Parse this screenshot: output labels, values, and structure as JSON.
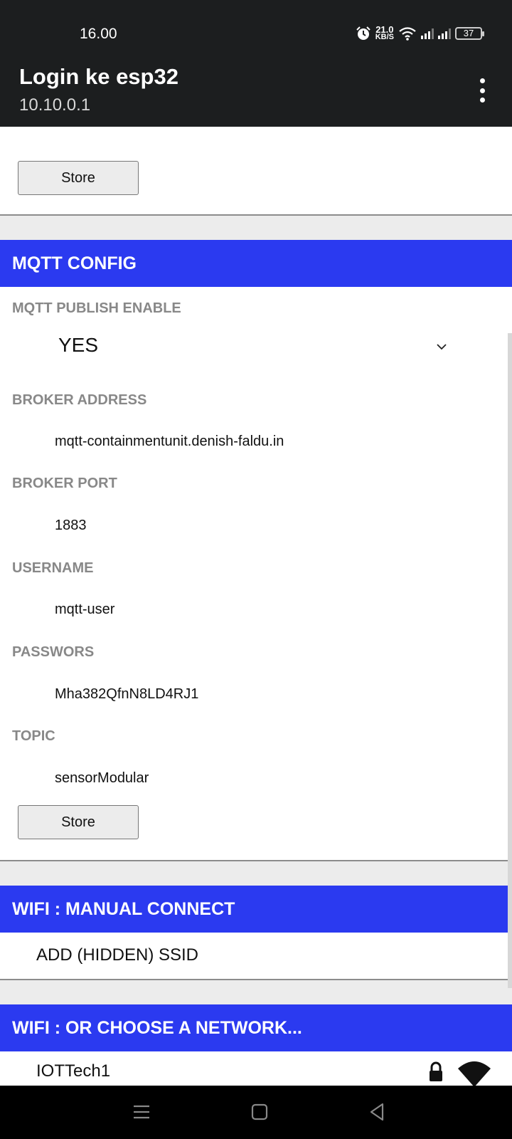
{
  "status_bar": {
    "time": "16.00",
    "net_speed_value": "21.0",
    "net_speed_unit": "KB/S",
    "battery": "37",
    "icons": [
      "alarm-icon",
      "wifi-icon",
      "signal-icon",
      "signal-icon",
      "battery-icon"
    ]
  },
  "app_bar": {
    "title": "Login ke esp32",
    "subtitle": "10.10.0.1",
    "menu_icon": "more-vert-icon"
  },
  "top_section": {
    "store_label": "Store"
  },
  "mqtt": {
    "header": "MQTT CONFIG",
    "publish_enable_label": "MQTT PUBLISH ENABLE",
    "publish_enable_value": "YES",
    "broker_address_label": "BROKER ADDRESS",
    "broker_address_value": "mqtt-containmentunit.denish-faldu.in",
    "broker_port_label": "BROKER PORT",
    "broker_port_value": "1883",
    "username_label": "USERNAME",
    "username_value": "mqtt-user",
    "password_label": "PASSWORS",
    "password_value": "Mha382QfnN8LD4RJ1",
    "topic_label": "TOPIC",
    "topic_value": "sensorModular",
    "store_label": "Store"
  },
  "wifi_manual": {
    "header": "WIFI : MANUAL CONNECT",
    "add_ssid_label": "ADD (HIDDEN) SSID"
  },
  "wifi_choose": {
    "header": "WIFI : OR CHOOSE A NETWORK...",
    "networks": [
      {
        "ssid": "IOTTech1",
        "icons": [
          "lock-icon",
          "wifi-signal-icon"
        ]
      }
    ]
  },
  "colors": {
    "header_blue": "#2b3af0",
    "app_bar_bg": "#1c1e1f",
    "label_gray": "#888888"
  },
  "nav_bar": {
    "icons": [
      "recents-icon",
      "home-icon",
      "back-icon"
    ]
  }
}
